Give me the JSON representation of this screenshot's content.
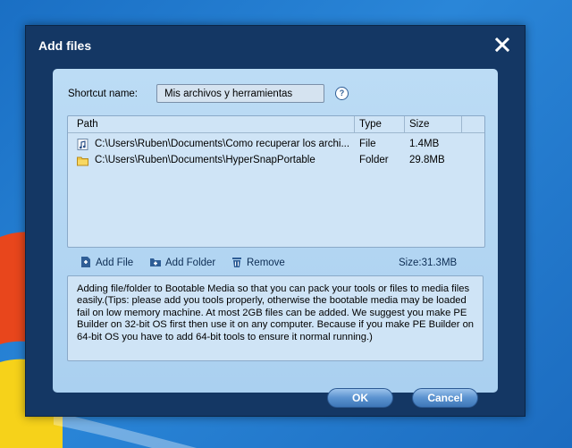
{
  "dialog": {
    "title": "Add files",
    "shortcut_label": "Shortcut name:",
    "shortcut_value": "Mis archivos y herramientas",
    "help": "?"
  },
  "list": {
    "columns": [
      "Path",
      "Type",
      "Size"
    ],
    "rows": [
      {
        "path": "C:\\Users\\Ruben\\Documents\\Como recuperar los archi...",
        "type": "File",
        "size": "1.4MB",
        "icon": "audio-file-icon"
      },
      {
        "path": "C:\\Users\\Ruben\\Documents\\HyperSnapPortable",
        "type": "Folder",
        "size": "29.8MB",
        "icon": "folder-icon"
      }
    ]
  },
  "toolbar": {
    "add_file": "Add File",
    "add_folder": "Add Folder",
    "remove": "Remove",
    "size_total": "Size:31.3MB"
  },
  "tips": "Adding file/folder to Bootable Media so that you can pack your tools or files to media files easily.(Tips: please add you tools properly, otherwise the bootable media may be loaded fail on low memory machine. At most 2GB files can be added. We suggest you make PE Builder on 32-bit OS first then use it on any computer. Because if you make PE Builder on 64-bit OS you have to add 64-bit tools to ensure it normal running.)",
  "buttons": {
    "ok": "OK",
    "cancel": "Cancel"
  },
  "colors": {
    "accent": "#5a92cf",
    "dialog_bg": "#143764",
    "panel_bg": "#aad0f0"
  }
}
